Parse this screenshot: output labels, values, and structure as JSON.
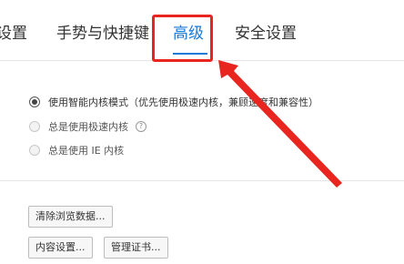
{
  "tabs": [
    {
      "label": "设置"
    },
    {
      "label": "手势与快捷键"
    },
    {
      "label": "高级",
      "active": true
    },
    {
      "label": "安全设置"
    }
  ],
  "kernel_options": [
    {
      "label": "使用智能内核模式（优先使用极速内核，兼顾速度和兼容性）",
      "checked": true
    },
    {
      "label": "总是使用极速内核",
      "checked": false
    },
    {
      "label": "总是使用 IE 内核",
      "checked": false
    }
  ],
  "help_icon_glyph": "?",
  "buttons": {
    "clear_browsing_data": "清除浏览数据...",
    "content_settings": "内容设置...",
    "manage_certificates": "管理证书..."
  },
  "colors": {
    "accent": "#1a7ad8",
    "annotation": "#e8251f"
  }
}
